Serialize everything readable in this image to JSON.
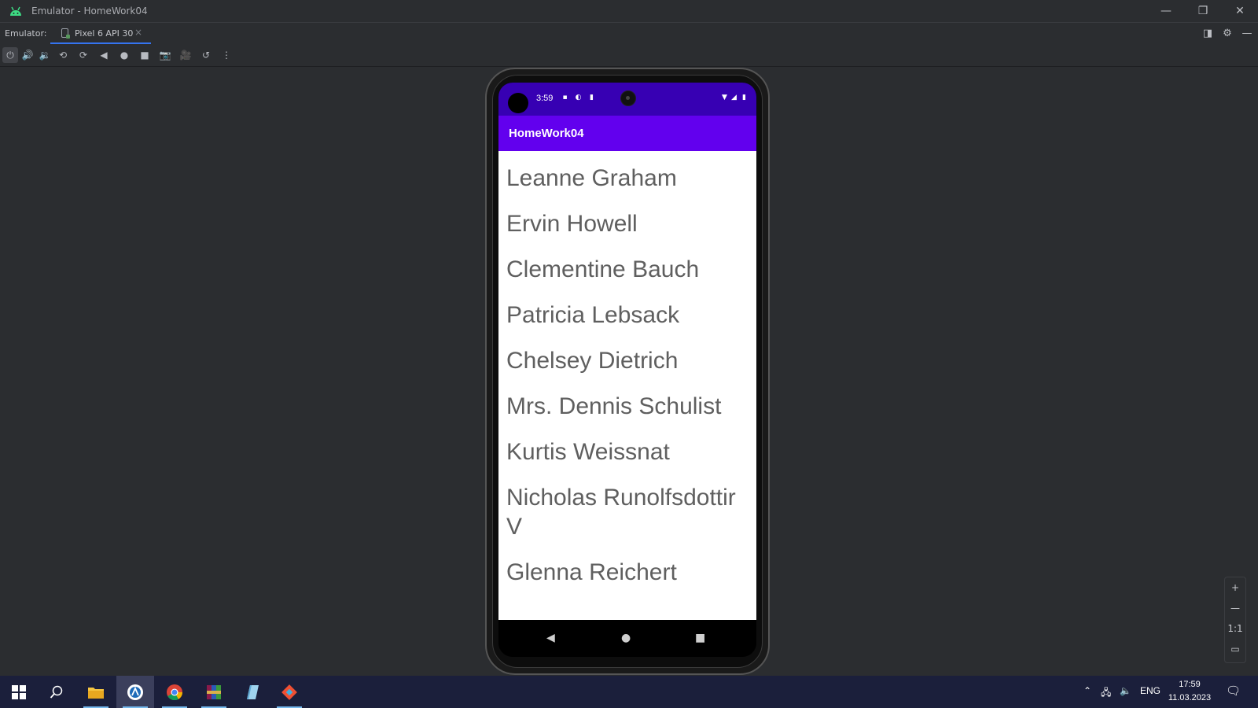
{
  "window": {
    "title": "Emulator - HomeWork04",
    "minimize": "—",
    "restore": "❐",
    "close": "✕"
  },
  "tabs_bar": {
    "label": "Emulator:",
    "tab_label": "Pixel 6 API 30",
    "tab_close": "×"
  },
  "device": {
    "status_time": "3:59",
    "app_title": "HomeWork04",
    "users": [
      "Leanne Graham",
      "Ervin Howell",
      "Clementine Bauch",
      "Patricia Lebsack",
      "Chelsey Dietrich",
      "Mrs. Dennis Schulist",
      "Kurtis Weissnat",
      "Nicholas Runolfsdottir V",
      "Glenna Reichert"
    ]
  },
  "zoom": {
    "zoom_in": "+",
    "zoom_out": "—",
    "actual_size": "1:1"
  },
  "taskbar": {
    "language": "ENG",
    "time": "17:59",
    "date": "11.03.2023"
  },
  "colors": {
    "status_bar": "#3700b3",
    "app_bar": "#6200ee",
    "tab_underline": "#3574f0"
  }
}
